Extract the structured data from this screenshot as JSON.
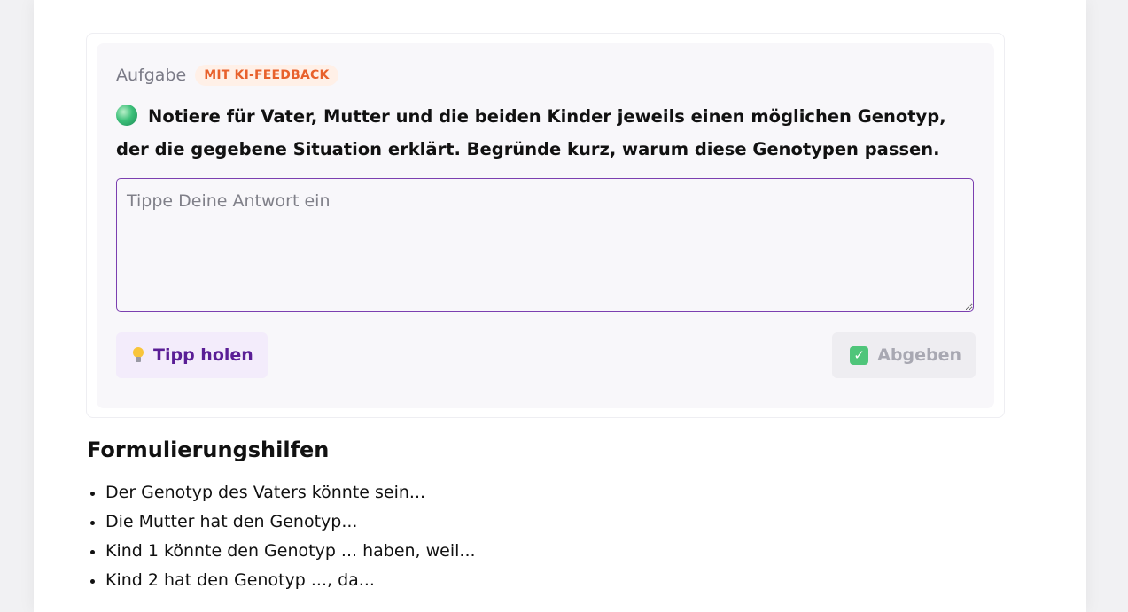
{
  "task": {
    "label": "Aufgabe",
    "badge": "MIT KI-FEEDBACK",
    "question": "Notiere für Vater, Mutter und die beiden Kinder jeweils einen möglichen Genotyp, der die gegebene Situation erklärt. Begründe kurz, warum diese Genotypen passen.",
    "question_icon": "green-dot-icon",
    "answer": {
      "placeholder": "Tippe Deine Antwort ein",
      "value": ""
    },
    "hint_button": {
      "label": "Tipp holen",
      "icon": "light-bulb-icon"
    },
    "submit_button": {
      "label": "Abgeben",
      "icon": "check-box-icon",
      "disabled": true
    }
  },
  "helpers": {
    "title": "Formulierungshilfen",
    "items": [
      "Der Genotyp des Vaters könnte sein...",
      "Die Mutter hat den Genotyp...",
      "Kind 1 könnte den Genotyp ... haben, weil...",
      "Kind 2 hat den Genotyp ..., da..."
    ]
  },
  "colors": {
    "accent": "#5a1e96",
    "badge_text": "#e8612c",
    "badge_bg": "#fff0e7",
    "answer_border": "#7b3fb0",
    "submit_check": "#4fc57a"
  }
}
